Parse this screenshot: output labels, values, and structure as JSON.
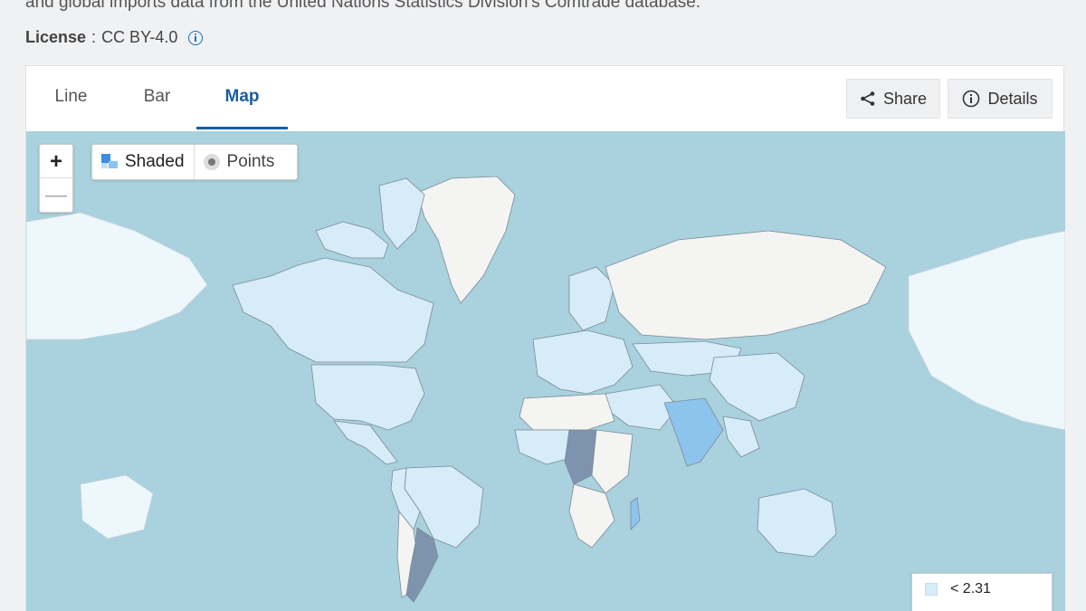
{
  "header": {
    "intro": "and global imports data from the United Nations Statistics Division's Comtrade database.",
    "license_label": "License",
    "license_sep": " : ",
    "license_value": "CC BY-4.0"
  },
  "tabs": [
    {
      "label": "Line",
      "active": false
    },
    {
      "label": "Bar",
      "active": false
    },
    {
      "label": "Map",
      "active": true
    }
  ],
  "actions": {
    "share_label": "Share",
    "details_label": "Details"
  },
  "map": {
    "zoom_in": "+",
    "zoom_out": "—",
    "layer_options": {
      "shaded": "Shaded",
      "points": "Points"
    },
    "selected_layer": "Shaded",
    "legend": [
      {
        "label": "< 2.31",
        "color": "#d6ecf8"
      }
    ],
    "colors": {
      "ocean": "#a9d1de",
      "no_data": "#f4f4f2",
      "light": "#d6ecf8",
      "medium": "#8dc4ee",
      "dark": "#7e93ad"
    }
  }
}
